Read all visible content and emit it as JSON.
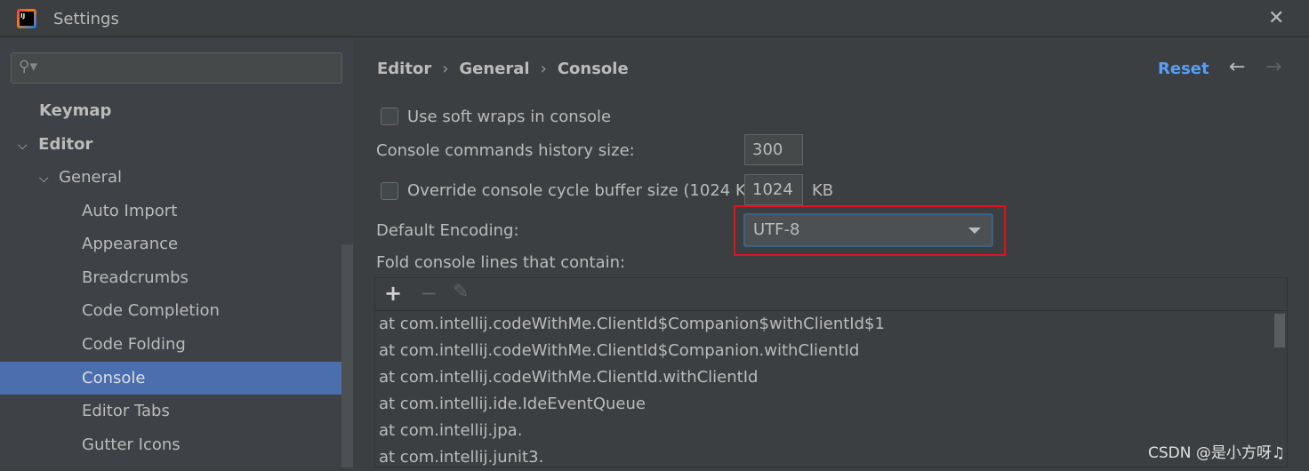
{
  "window": {
    "title": "Settings",
    "logo_text": "IJ",
    "close": "✕"
  },
  "sidebar": {
    "search_placeholder": "",
    "items": [
      {
        "label": "Keymap",
        "bold": true
      },
      {
        "label": "Editor",
        "bold": true,
        "expanded": true
      },
      {
        "label": "General",
        "expanded": true
      },
      {
        "label": "Auto Import"
      },
      {
        "label": "Appearance"
      },
      {
        "label": "Breadcrumbs"
      },
      {
        "label": "Code Completion"
      },
      {
        "label": "Code Folding"
      },
      {
        "label": "Console",
        "selected": true
      },
      {
        "label": "Editor Tabs"
      },
      {
        "label": "Gutter Icons"
      }
    ]
  },
  "breadcrumb": [
    "Editor",
    "General",
    "Console"
  ],
  "header": {
    "reset": "Reset",
    "back": "←",
    "forward": "→"
  },
  "form": {
    "soft_wraps": {
      "label": "Use soft wraps in console",
      "checked": false
    },
    "history": {
      "label": "Console commands history size:",
      "value": "300"
    },
    "buffer": {
      "label": "Override console cycle buffer size (1024 KB)",
      "checked": false,
      "value": "1024",
      "unit": "KB"
    },
    "encoding": {
      "label": "Default Encoding:",
      "value": "UTF-8"
    },
    "fold": {
      "label": "Fold console lines that contain:",
      "add": "+",
      "remove": "−",
      "edit": "✎",
      "lines": [
        "at com.intellij.codeWithMe.ClientId$Companion$withClientId$1",
        "at com.intellij.codeWithMe.ClientId$Companion.withClientId",
        "at com.intellij.codeWithMe.ClientId.withClientId",
        "at com.intellij.ide.IdeEventQueue",
        "at com.intellij.jpa.",
        "at com.intellij.junit3."
      ]
    }
  },
  "watermark": "CSDN @是小方呀♫",
  "colors": {
    "accent": "#589df6",
    "selection": "#4b6eaf",
    "highlight": "#e0131a"
  }
}
